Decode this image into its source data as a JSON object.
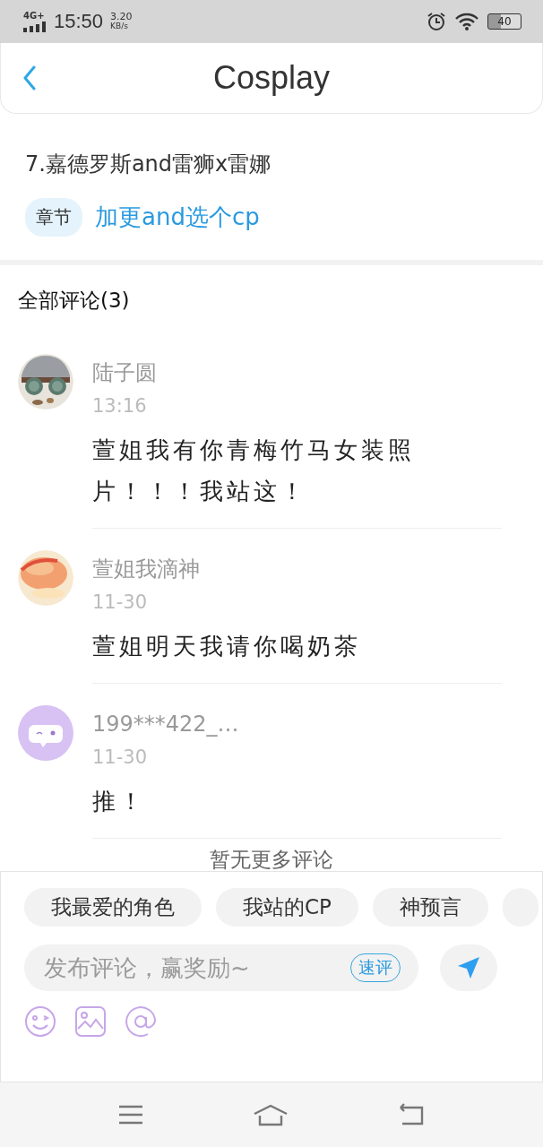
{
  "status_bar": {
    "network": "4G+",
    "time": "15:50",
    "speed": "3.20",
    "speed_unit": "KB/s",
    "battery": "40"
  },
  "header": {
    "title": "Cosplay"
  },
  "chapter": {
    "title": "7.嘉德罗斯and雷狮x雷娜",
    "tag": "章节",
    "link": "加更and选个cp"
  },
  "comments_header": "全部评论(3)",
  "comments": [
    {
      "name": "陆子圆",
      "time": "13:16",
      "text": "萱姐我有你青梅竹马女装照片！！！我站这！"
    },
    {
      "name": "萱姐我滴神",
      "time": "11-30",
      "text": "萱姐明天我请你喝奶茶"
    },
    {
      "avatar": {
        "kind": "default"
      },
      "name": "199***422_…",
      "time": "11-30",
      "text": "推！"
    }
  ],
  "end_note": "暂无更多评论",
  "composer": {
    "chips": [
      "我最爱的角色",
      "我站的CP",
      "神预言"
    ],
    "placeholder": "发布评论，赢奖励~",
    "quick_button": "速评"
  }
}
